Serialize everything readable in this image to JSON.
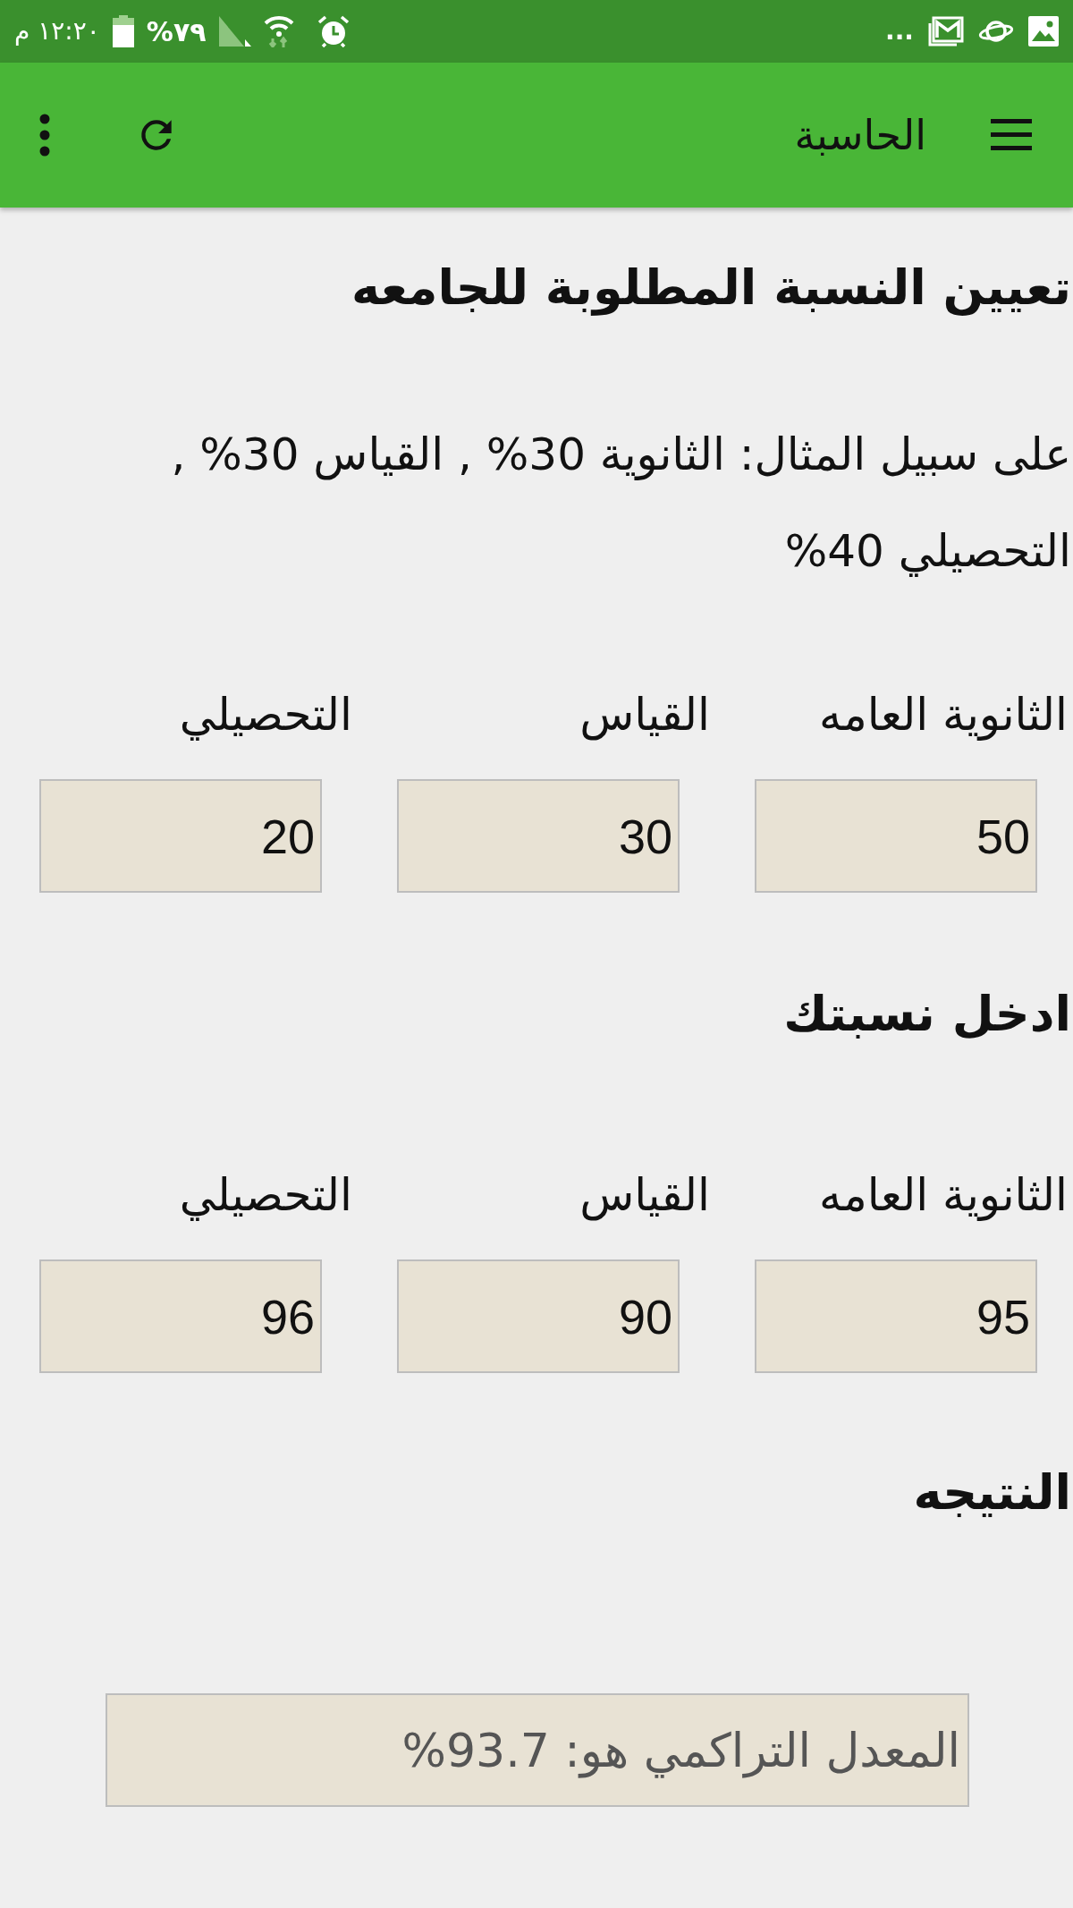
{
  "status_bar": {
    "time": "١٢:٢٠ م",
    "battery": "٧٩%",
    "overflow": "..."
  },
  "app_bar": {
    "title": "الحاسبة"
  },
  "required_section": {
    "heading": "تعيين النسبة المطلوبة للجامعه",
    "example": "على سبيل المثال: الثانوية 30% , القياس 30% , التحصيلي 40%",
    "fields": [
      {
        "label": "الثانوية العامه",
        "value": "50"
      },
      {
        "label": "القياس",
        "value": "30"
      },
      {
        "label": "التحصيلي",
        "value": "20"
      }
    ]
  },
  "score_section": {
    "heading": "ادخل نسبتك",
    "fields": [
      {
        "label": "الثانوية العامه",
        "value": "95"
      },
      {
        "label": "القياس",
        "value": "90"
      },
      {
        "label": "التحصيلي",
        "value": "96"
      }
    ]
  },
  "result_section": {
    "heading": "النتيجه",
    "result": "المعدل التراكمي هو: 93.7%"
  }
}
